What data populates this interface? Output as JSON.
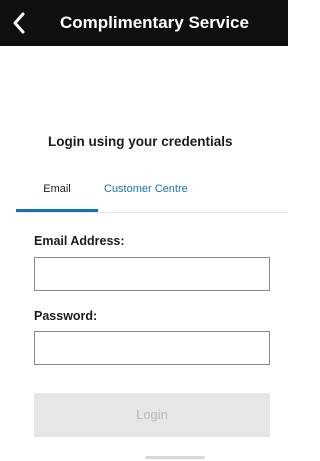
{
  "header": {
    "title": "Complimentary Service",
    "back_icon": "chevron-left-icon"
  },
  "login": {
    "subtitle": "Login using your credentials",
    "tabs": [
      {
        "label": "Email",
        "active": true
      },
      {
        "label": "Customer Centre",
        "active": false
      }
    ],
    "email_label": "Email Address:",
    "email_value": "",
    "password_label": "Password:",
    "password_value": "",
    "submit_label": "Login"
  },
  "colors": {
    "topbar": "#0f0f0f",
    "accent": "#1672ac",
    "button_disabled_bg": "#e6e6e6",
    "button_disabled_text": "#b9b9b9"
  }
}
